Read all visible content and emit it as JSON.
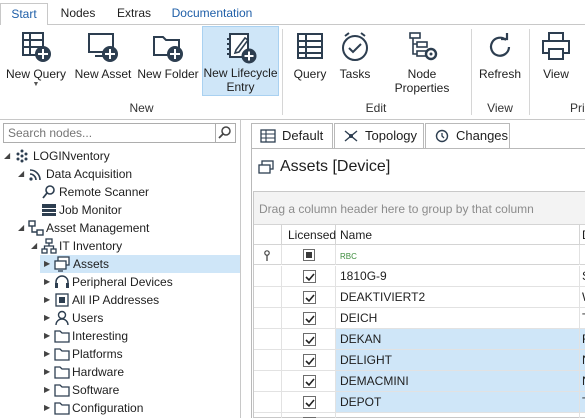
{
  "tabs": [
    "Start",
    "Nodes",
    "Extras",
    "Documentation"
  ],
  "ribbon": {
    "groups": [
      {
        "label": "New",
        "buttons": [
          "New Query",
          "New Asset",
          "New Folder",
          "New Lifecycle\nEntry"
        ]
      },
      {
        "label": "Edit",
        "buttons": [
          "Query",
          "Tasks",
          "Node Properties"
        ]
      },
      {
        "label": "View",
        "buttons": [
          "Refresh"
        ]
      },
      {
        "label": "Prin",
        "buttons": [
          "View"
        ]
      }
    ],
    "new_query": {
      "line1": "New Query"
    },
    "new_asset": "New Asset",
    "new_folder": "New Folder",
    "new_lifecycle": {
      "line1": "New Lifecycle",
      "line2": "Entry"
    },
    "query": "Query",
    "tasks": "Tasks",
    "node_properties": "Node Properties",
    "refresh": "Refresh",
    "view": "View",
    "group_new": "New",
    "group_edit": "Edit",
    "group_view": "View",
    "group_print": "Prin"
  },
  "search": {
    "placeholder": "Search nodes..."
  },
  "tree": {
    "items": [
      {
        "label": "LOGINventory",
        "icon": "root-icon"
      },
      {
        "label": "Data Acquisition",
        "icon": "signal-icon"
      },
      {
        "label": "Remote Scanner",
        "icon": "magnifier-icon"
      },
      {
        "label": "Job Monitor",
        "icon": "monitor-icon"
      },
      {
        "label": "Asset Management",
        "icon": "tree-icon"
      },
      {
        "label": "IT Inventory",
        "icon": "network-icon"
      },
      {
        "label": "Assets",
        "icon": "assets-icon"
      },
      {
        "label": "Peripheral Devices",
        "icon": "headset-icon"
      },
      {
        "label": "All IP Addresses",
        "icon": "ip-icon"
      },
      {
        "label": "Users",
        "icon": "user-icon"
      },
      {
        "label": "Interesting",
        "icon": "folder-icon"
      },
      {
        "label": "Platforms",
        "icon": "folder-icon"
      },
      {
        "label": "Hardware",
        "icon": "folder-icon"
      },
      {
        "label": "Software",
        "icon": "folder-icon"
      },
      {
        "label": "Configuration",
        "icon": "folder-icon"
      }
    ]
  },
  "view_tabs": [
    "Default",
    "Topology",
    "Changes"
  ],
  "assets_title": "Assets  [Device]",
  "grid": {
    "group_hint": "Drag a column header here to group by that column",
    "columns": [
      "Licensed",
      "Name",
      "D"
    ],
    "filter_name": "RBC",
    "rows": [
      {
        "name": "1810G-9",
        "licensed": true,
        "d": "S",
        "selected": false
      },
      {
        "name": "DEAKTIVIERT2",
        "licensed": true,
        "d": "W",
        "selected": false
      },
      {
        "name": "DEICH",
        "licensed": true,
        "d": "T",
        "selected": false
      },
      {
        "name": "DEKAN",
        "licensed": true,
        "d": "F",
        "selected": true
      },
      {
        "name": "DELIGHT",
        "licensed": true,
        "d": "N",
        "selected": true
      },
      {
        "name": "DEMACMINI",
        "licensed": true,
        "d": "N",
        "selected": true
      },
      {
        "name": "DEPOT",
        "licensed": true,
        "d": "T",
        "selected": true
      },
      {
        "name": "",
        "licensed": true,
        "d": "",
        "selected": false
      }
    ]
  },
  "colors": {
    "accent": "#1f5fa8",
    "selection": "#cfe6f8",
    "border": "#c8c8c8"
  }
}
